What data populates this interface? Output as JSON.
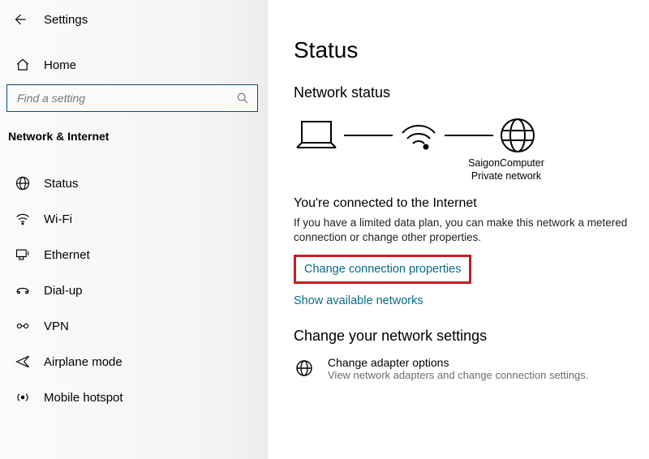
{
  "header": {
    "title": "Settings"
  },
  "home_label": "Home",
  "search": {
    "placeholder": "Find a setting"
  },
  "category": "Network & Internet",
  "nav": [
    {
      "label": "Status"
    },
    {
      "label": "Wi-Fi"
    },
    {
      "label": "Ethernet"
    },
    {
      "label": "Dial-up"
    },
    {
      "label": "VPN"
    },
    {
      "label": "Airplane mode"
    },
    {
      "label": "Mobile hotspot"
    }
  ],
  "main": {
    "page_title": "Status",
    "section_title": "Network status",
    "network_name": "SaigonComputer",
    "network_type": "Private network",
    "connected_title": "You're connected to the Internet",
    "connected_desc": "If you have a limited data plan, you can make this network a metered connection or change other properties.",
    "link_change_props": "Change connection properties",
    "link_show_networks": "Show available networks",
    "settings_title": "Change your network settings",
    "adapter_label": "Change adapter options",
    "adapter_desc": "View network adapters and change connection settings."
  }
}
